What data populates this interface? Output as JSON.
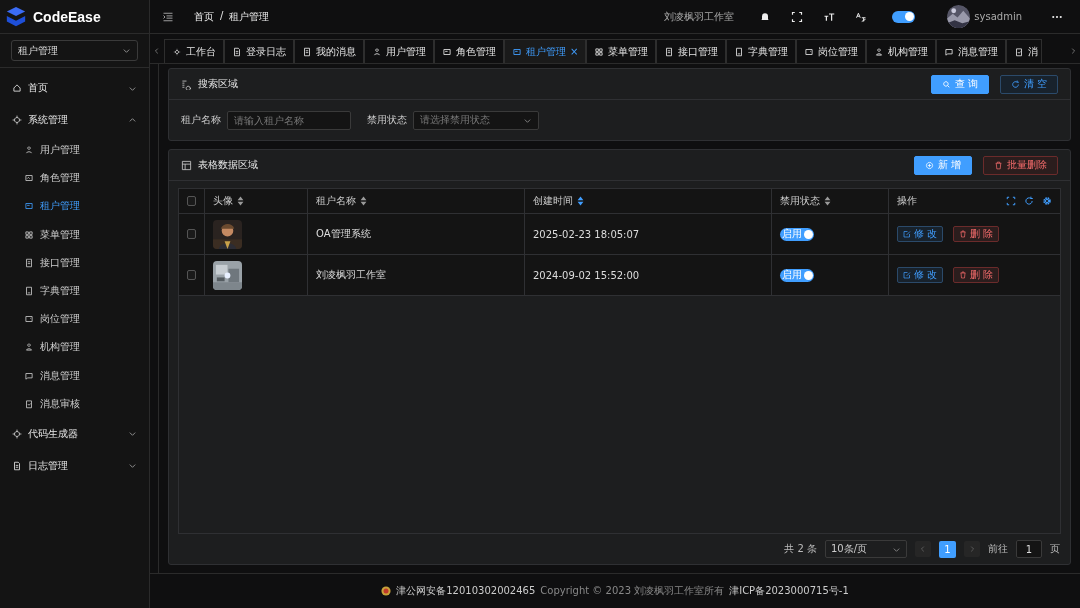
{
  "app": {
    "name": "CodeEase"
  },
  "header": {
    "breadcrumb": {
      "items": [
        "首页",
        "租户管理"
      ],
      "separator": "/"
    },
    "studio": "刘凌枫羽工作室",
    "theme_switch": {
      "on": true
    },
    "user": "sysadmin"
  },
  "sidebar": {
    "select": "租户管理",
    "items": [
      {
        "label": "首页",
        "expanded": false
      },
      {
        "label": "系统管理",
        "expanded": true,
        "children": [
          {
            "label": "用户管理",
            "selected": false
          },
          {
            "label": "角色管理",
            "selected": false
          },
          {
            "label": "租户管理",
            "selected": true
          },
          {
            "label": "菜单管理",
            "selected": false
          },
          {
            "label": "接口管理",
            "selected": false
          },
          {
            "label": "字典管理",
            "selected": false
          },
          {
            "label": "岗位管理",
            "selected": false
          },
          {
            "label": "机构管理",
            "selected": false
          },
          {
            "label": "消息管理",
            "selected": false
          },
          {
            "label": "消息审核",
            "selected": false
          }
        ]
      },
      {
        "label": "代码生成器",
        "expanded": false
      },
      {
        "label": "日志管理",
        "expanded": false
      }
    ]
  },
  "tabs": [
    {
      "label": "工作台",
      "selected": false
    },
    {
      "label": "登录日志",
      "selected": false
    },
    {
      "label": "我的消息",
      "selected": false
    },
    {
      "label": "用户管理",
      "selected": false
    },
    {
      "label": "角色管理",
      "selected": false
    },
    {
      "label": "租户管理",
      "selected": true,
      "close": "×"
    },
    {
      "label": "菜单管理",
      "selected": false
    },
    {
      "label": "接口管理",
      "selected": false
    },
    {
      "label": "字典管理",
      "selected": false
    },
    {
      "label": "岗位管理",
      "selected": false
    },
    {
      "label": "机构管理",
      "selected": false
    },
    {
      "label": "消息管理",
      "selected": false
    },
    {
      "label": "消",
      "selected": false
    }
  ],
  "search": {
    "title": "搜索区域",
    "buttons": [
      "查 询",
      "清 空"
    ],
    "fields": [
      {
        "label": "租户名称",
        "kind": "input",
        "placeholder": "请输入租户名称"
      },
      {
        "label": "禁用状态",
        "kind": "select",
        "placeholder": "请选择禁用状态"
      }
    ]
  },
  "table_card": {
    "title": "表格数据区域",
    "add": "新 增",
    "batch_delete": "批量删除"
  },
  "table": {
    "select_all": {
      "checked": false
    },
    "columns": [
      {
        "label": "头像",
        "sorted": false
      },
      {
        "label": "租户名称",
        "sorted": false
      },
      {
        "label": "创建时间",
        "sorted": true
      },
      {
        "label": "禁用状态",
        "sorted": false
      },
      {
        "label": "操作"
      }
    ],
    "rows": [
      {
        "checked": false,
        "name": "OA管理系统",
        "created": "2025-02-23 18:05:07",
        "status": {
          "label": "启用",
          "on": true
        },
        "actions": [
          "修 改",
          "删 除"
        ]
      },
      {
        "checked": false,
        "name": "刘凌枫羽工作室",
        "created": "2024-09-02 15:52:00",
        "status": {
          "label": "启用",
          "on": true
        },
        "actions": [
          "修 改",
          "删 除"
        ]
      }
    ]
  },
  "pagination": {
    "total": "共 2 条",
    "page_size": "10条/页",
    "pages": [
      {
        "label": "1",
        "selected": true
      }
    ],
    "goto": "前往",
    "goto_value": "1",
    "page_unit": "页"
  },
  "footer": {
    "police": "津公网安备12010302002465",
    "copyright": "Copyright © 2023 刘凌枫羽工作室所有",
    "icp": "津ICP备2023000715号-1"
  }
}
